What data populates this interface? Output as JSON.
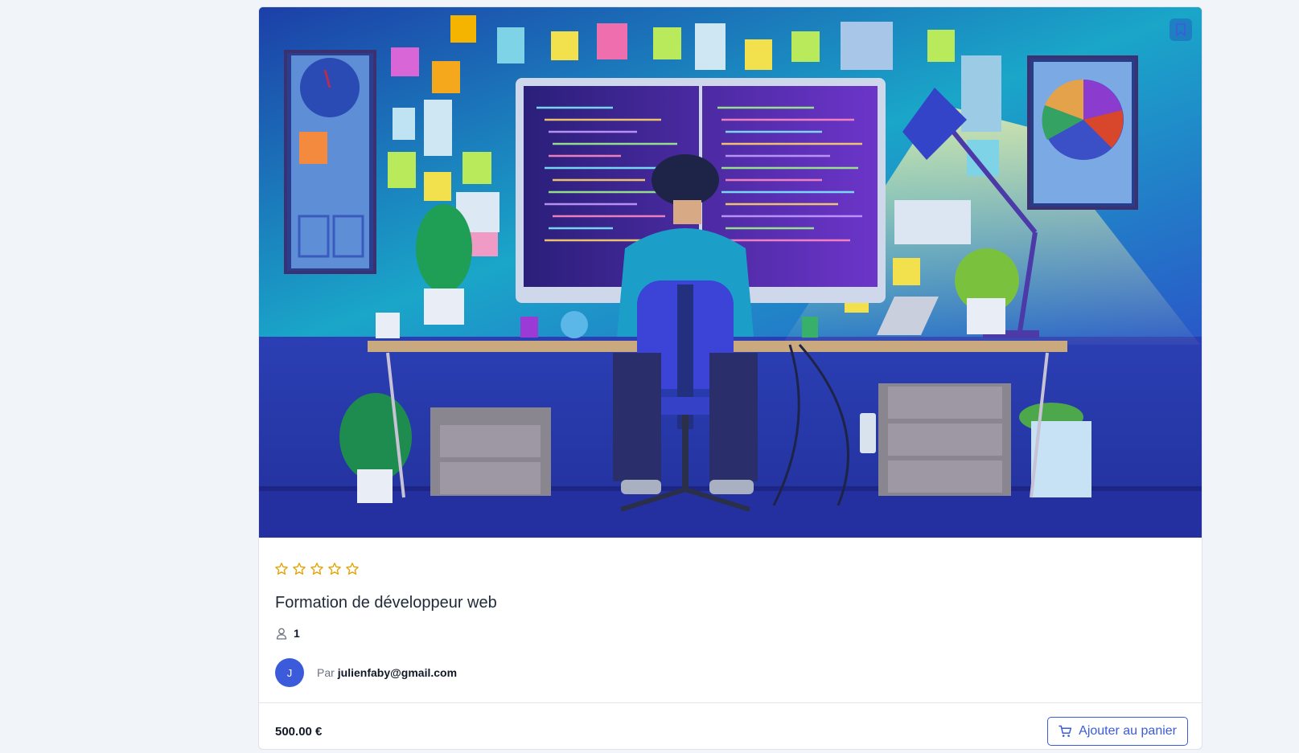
{
  "course": {
    "rating": {
      "value": 0,
      "max": 5
    },
    "title": "Formation de développeur web",
    "students_count": "1",
    "author": {
      "avatar_initial": "J",
      "by_label": "Par",
      "email": "julienfaby@gmail.com"
    },
    "price": "500.00 €",
    "add_to_cart_label": "Ajouter au panier"
  },
  "icons": {
    "bookmark": "bookmark-icon",
    "star": "star-outline-icon",
    "user": "user-icon",
    "cart": "cart-icon"
  },
  "colors": {
    "page_background": "#f1f5f9",
    "accent": "#3b5bdb",
    "star": "#e8a200",
    "text_dark": "#1f2937",
    "text_muted": "#6b7280"
  }
}
